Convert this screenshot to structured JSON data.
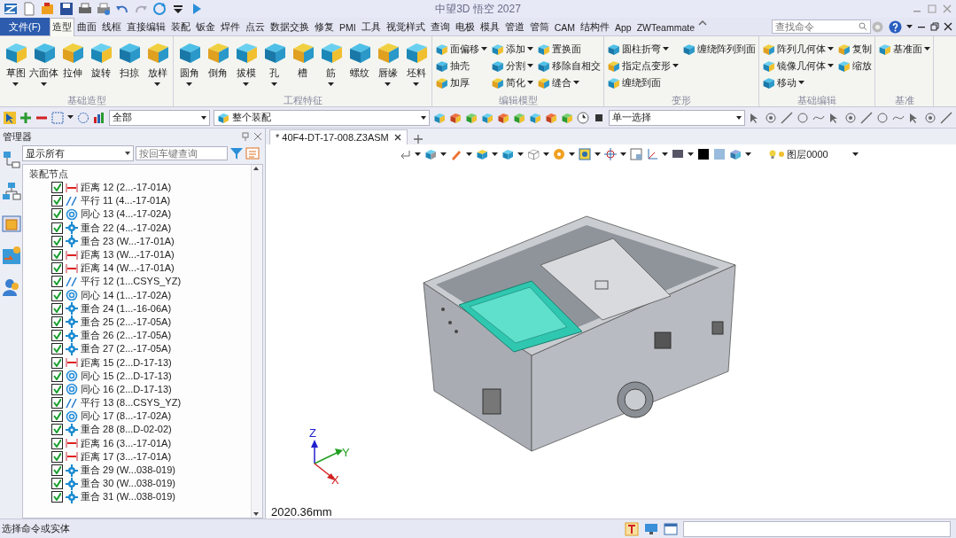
{
  "window": {
    "title": "中望3D 悟空 2027"
  },
  "menu": {
    "file": "文件(F)",
    "tabs": [
      {
        "label": "造型",
        "selected": true
      },
      {
        "label": "曲面",
        "selected": false
      },
      {
        "label": "线框",
        "selected": false
      },
      {
        "label": "直接编辑",
        "selected": false
      },
      {
        "label": "装配",
        "selected": false
      },
      {
        "label": "钣金",
        "selected": false
      },
      {
        "label": "焊件",
        "selected": false
      },
      {
        "label": "点云",
        "selected": false
      },
      {
        "label": "数据交换",
        "selected": false
      },
      {
        "label": "修复",
        "selected": false
      },
      {
        "label": "PMI",
        "selected": false
      },
      {
        "label": "工具",
        "selected": false
      },
      {
        "label": "视觉样式",
        "selected": false
      },
      {
        "label": "查询",
        "selected": false
      },
      {
        "label": "电极",
        "selected": false
      },
      {
        "label": "模具",
        "selected": false
      },
      {
        "label": "管道",
        "selected": false
      },
      {
        "label": "管筒",
        "selected": false
      },
      {
        "label": "CAM",
        "selected": false
      },
      {
        "label": "结构件",
        "selected": false
      },
      {
        "label": "App",
        "selected": false
      },
      {
        "label": "ZWTeammate",
        "selected": false
      }
    ],
    "search": {
      "placeholder": "查找命令"
    }
  },
  "ribbon": {
    "groups": [
      {
        "label": "基础造型",
        "kind": "large",
        "tools": [
          {
            "label": "草图",
            "dropdown": true
          },
          {
            "label": "六面体",
            "dropdown": true
          },
          {
            "label": "拉伸",
            "dropdown": false
          },
          {
            "label": "旋转",
            "dropdown": false
          },
          {
            "label": "扫掠",
            "dropdown": false
          },
          {
            "label": "放样",
            "dropdown": true
          }
        ]
      },
      {
        "label": "工程特征",
        "kind": "large",
        "tools": [
          {
            "label": "圆角",
            "dropdown": true
          },
          {
            "label": "倒角",
            "dropdown": false
          },
          {
            "label": "拔模",
            "dropdown": true
          },
          {
            "label": "孔",
            "dropdown": true
          },
          {
            "label": "槽",
            "dropdown": false
          },
          {
            "label": "筋",
            "dropdown": true
          },
          {
            "label": "螺纹",
            "dropdown": false
          },
          {
            "label": "唇缘",
            "dropdown": true
          },
          {
            "label": "坯料",
            "dropdown": true
          }
        ]
      },
      {
        "label": "编辑模型",
        "kind": "small",
        "tools": [
          {
            "label": "面偏移",
            "dropdown": true
          },
          {
            "label": "抽壳",
            "dropdown": false
          },
          {
            "label": "加厚",
            "dropdown": false
          },
          {
            "label": "添加",
            "dropdown": true
          },
          {
            "label": "分割",
            "dropdown": true
          },
          {
            "label": "简化",
            "dropdown": true
          },
          {
            "label": "置换面",
            "dropdown": false
          },
          {
            "label": "移除自相交",
            "dropdown": false
          },
          {
            "label": "缝合",
            "dropdown": true
          }
        ]
      },
      {
        "label": "变形",
        "kind": "small",
        "tools": [
          {
            "label": "圆柱折弯",
            "dropdown": true
          },
          {
            "label": "指定点变形",
            "dropdown": true
          },
          {
            "label": "缠绕到面",
            "dropdown": false
          },
          {
            "label": "缠绕阵列到面",
            "dropdown": false
          }
        ]
      },
      {
        "label": "基础编辑",
        "kind": "small",
        "tools": [
          {
            "label": "阵列几何体",
            "dropdown": true
          },
          {
            "label": "镜像几何体",
            "dropdown": true
          },
          {
            "label": "移动",
            "dropdown": true
          },
          {
            "label": "复制",
            "dropdown": false
          },
          {
            "label": "缩放",
            "dropdown": false
          }
        ]
      },
      {
        "label": "基准",
        "kind": "small",
        "tools": [
          {
            "label": "基准面",
            "dropdown": true
          }
        ]
      }
    ]
  },
  "toolbar": {
    "filter": "全部",
    "scope": "整个装配",
    "select_mode": "单一选择"
  },
  "manager": {
    "title": "管理器",
    "display": "显示所有",
    "search": {
      "placeholder": "按回车键查询"
    },
    "root": "装配节点",
    "rows": [
      {
        "kind": "distance",
        "label": "距离 12 (2...-17-01A)",
        "checked": true
      },
      {
        "kind": "parallel",
        "label": "平行 11 (4...-17-01A)",
        "checked": true
      },
      {
        "kind": "concentric",
        "label": "同心 13 (4...-17-02A)",
        "checked": true
      },
      {
        "kind": "coincident",
        "label": "重合 22 (4...-17-02A)",
        "checked": true
      },
      {
        "kind": "coincident",
        "label": "重合 23 (W...-17-01A)",
        "checked": true
      },
      {
        "kind": "distance",
        "label": "距离 13 (W...-17-01A)",
        "checked": true
      },
      {
        "kind": "distance",
        "label": "距离 14 (W...-17-01A)",
        "checked": true
      },
      {
        "kind": "parallel",
        "label": "平行 12 (1...CSYS_YZ)",
        "checked": true
      },
      {
        "kind": "concentric",
        "label": "同心 14 (1...-17-02A)",
        "checked": true
      },
      {
        "kind": "coincident",
        "label": "重合 24 (1...-16-06A)",
        "checked": true
      },
      {
        "kind": "coincident",
        "label": "重合 25 (2...-17-05A)",
        "checked": true
      },
      {
        "kind": "coincident",
        "label": "重合 26 (2...-17-05A)",
        "checked": true
      },
      {
        "kind": "coincident",
        "label": "重合 27 (2...-17-05A)",
        "checked": true
      },
      {
        "kind": "distance",
        "label": "距离 15 (2...D-17-13)",
        "checked": true
      },
      {
        "kind": "concentric",
        "label": "同心 15 (2...D-17-13)",
        "checked": true
      },
      {
        "kind": "concentric",
        "label": "同心 16 (2...D-17-13)",
        "checked": true
      },
      {
        "kind": "parallel",
        "label": "平行 13 (8...CSYS_YZ)",
        "checked": true
      },
      {
        "kind": "concentric",
        "label": "同心 17 (8...-17-02A)",
        "checked": true
      },
      {
        "kind": "coincident",
        "label": "重合 28 (8...D-02-02)",
        "checked": true
      },
      {
        "kind": "distance",
        "label": "距离 16 (3...-17-01A)",
        "checked": true
      },
      {
        "kind": "distance",
        "label": "距离 17 (3...-17-01A)",
        "checked": true
      },
      {
        "kind": "coincident",
        "label": "重合 29 (W...038-019)",
        "checked": true
      },
      {
        "kind": "coincident",
        "label": "重合 30 (W...038-019)",
        "checked": true
      },
      {
        "kind": "coincident",
        "label": "重合 31 (W...038-019)",
        "checked": true
      }
    ]
  },
  "document": {
    "tab": "* 40F4-DT-17-008.Z3ASM"
  },
  "viewport": {
    "layer": "图层0000",
    "axes": {
      "x": "X",
      "y": "Y",
      "z": "Z"
    },
    "scale": "2020.36mm"
  },
  "status_bar": {
    "prompt": "选择命令或实体"
  }
}
